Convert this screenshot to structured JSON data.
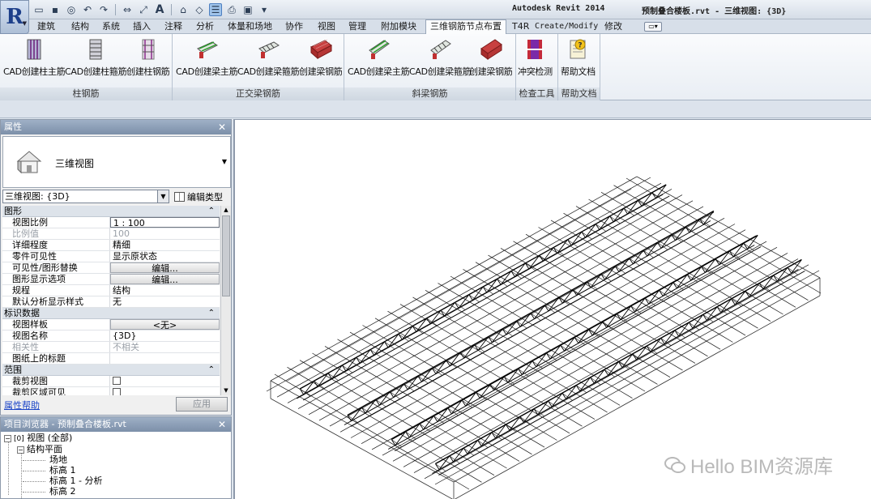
{
  "titlebar": {
    "app_name": "Autodesk Revit 2014",
    "document": "预制叠合楼板.rvt - 三维视图: {3D}"
  },
  "app_button": {
    "glyph": "R",
    "icon": "revit-logo-icon"
  },
  "qat": {
    "items": [
      "open-icon",
      "save-icon",
      "sync-icon",
      "undo-icon",
      "redo-icon",
      "align-icon",
      "measure-icon",
      "text-icon",
      "default-3d-icon",
      "thin-lines-icon",
      "print-icon",
      "switch-windows-icon",
      "customize-icon"
    ],
    "text_glyph": "A"
  },
  "tabs": [
    "建筑",
    "结构",
    "系统",
    "插入",
    "注释",
    "分析",
    "体量和场地",
    "协作",
    "视图",
    "管理",
    "附加模块",
    "三维钢筋节点布置",
    "T4R",
    "Create/Modify",
    "修改"
  ],
  "active_tab": "三维钢筋节点布置",
  "ribbon": {
    "panels": [
      {
        "title": "柱钢筋",
        "buttons": [
          "CAD创建柱主筋",
          "CAD创建柱箍筋",
          "创建柱钢筋"
        ]
      },
      {
        "title": "正交梁钢筋",
        "buttons": [
          "CAD创建梁主筋",
          "CAD创建梁箍筋",
          "创建梁钢筋"
        ]
      },
      {
        "title": "斜梁钢筋",
        "buttons": [
          "CAD创建梁主筋",
          "CAD创建梁箍筋",
          "创建梁钢筋"
        ]
      },
      {
        "title": "检查工具",
        "buttons": [
          "冲突检测"
        ]
      },
      {
        "title": "帮助文档",
        "buttons": [
          "帮助文档"
        ]
      }
    ]
  },
  "properties": {
    "header": "属性",
    "close": "✕",
    "type_name": "三维视图",
    "view_selector": "三维视图: {3D}",
    "edit_type": "编辑类型",
    "groups": [
      {
        "name": "图形",
        "rows": [
          {
            "k": "视图比例",
            "v": "1 : 100",
            "style": "box"
          },
          {
            "k": "比例值",
            "v": "100",
            "style": "dim"
          },
          {
            "k": "详细程度",
            "v": "精细"
          },
          {
            "k": "零件可见性",
            "v": "显示原状态"
          },
          {
            "k": "可见性/图形替换",
            "v": "编辑...",
            "style": "btn"
          },
          {
            "k": "图形显示选项",
            "v": "编辑...",
            "style": "btn"
          },
          {
            "k": "规程",
            "v": "结构"
          },
          {
            "k": "默认分析显示样式",
            "v": "无"
          }
        ]
      },
      {
        "name": "标识数据",
        "rows": [
          {
            "k": "视图样板",
            "v": "<无>",
            "style": "btn"
          },
          {
            "k": "视图名称",
            "v": "{3D}"
          },
          {
            "k": "相关性",
            "v": "不相关",
            "style": "dim"
          },
          {
            "k": "图纸上的标题",
            "v": ""
          }
        ]
      },
      {
        "name": "范围",
        "rows": [
          {
            "k": "裁剪视图",
            "v": "",
            "style": "chk"
          },
          {
            "k": "裁剪区域可见",
            "v": "",
            "style": "chk"
          }
        ]
      }
    ],
    "help_link": "属性帮助",
    "apply": "应用"
  },
  "browser": {
    "header": "项目浏览器 - 预制叠合楼板.rvt",
    "close": "✕",
    "nodes": [
      "视图 (全部)",
      "结构平面",
      "场地",
      "标高 1",
      "标高 1 - 分析",
      "标高 2"
    ]
  },
  "watermark": "Hello BIM资源库"
}
